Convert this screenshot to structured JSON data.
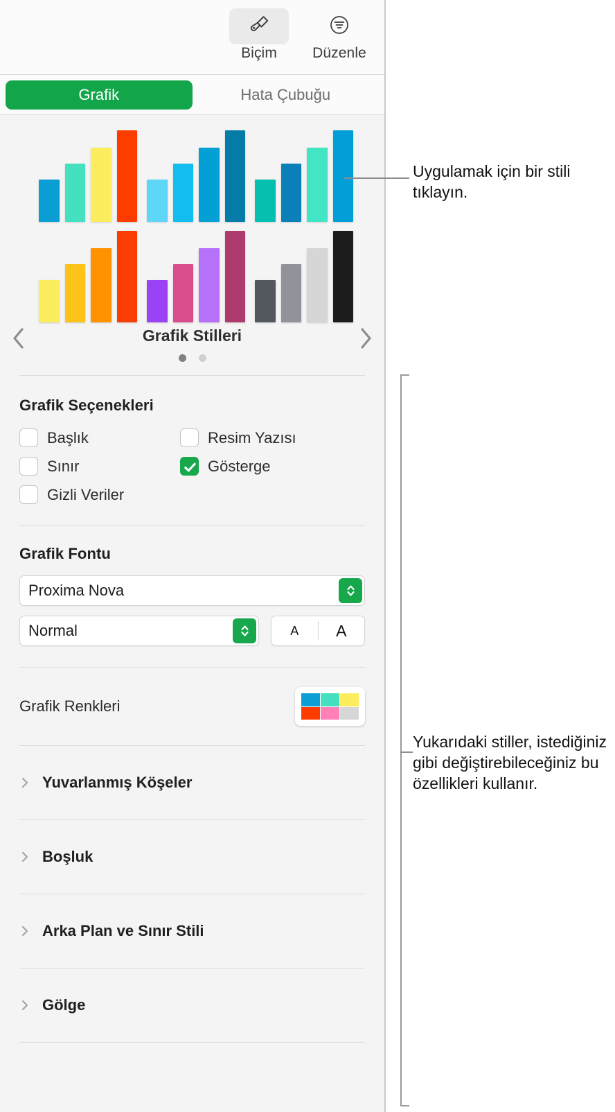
{
  "toolbar": {
    "buttons": [
      {
        "label": "Biçim",
        "icon": "paintbrush-icon",
        "active": true
      },
      {
        "label": "Düzenle",
        "icon": "edit-lines-circle-icon",
        "active": false
      }
    ]
  },
  "tabs": [
    {
      "label": "Grafik",
      "selected": true
    },
    {
      "label": "Hata Çubuğu",
      "selected": false
    }
  ],
  "carousel": {
    "title": "Grafik Stilleri",
    "prev_icon": "chevron-left-icon",
    "next_icon": "chevron-right-icon",
    "page_count": 2,
    "active_page": 1,
    "styles": [
      {
        "name": "style-1",
        "colors": [
          "#0a9ed4",
          "#44e0c0",
          "#fbed5e",
          "#ff3c00"
        ],
        "heights": [
          46,
          64,
          81,
          100
        ]
      },
      {
        "name": "style-2",
        "colors": [
          "#5ed6f7",
          "#12bdf0",
          "#02a0d4",
          "#057ca8"
        ],
        "heights": [
          46,
          64,
          81,
          100
        ]
      },
      {
        "name": "style-3",
        "colors": [
          "#07bfae",
          "#0b80b8",
          "#42e6c4",
          "#029ed8"
        ],
        "heights": [
          46,
          64,
          81,
          100
        ]
      },
      {
        "name": "style-4",
        "colors": [
          "#fbed5e",
          "#fcc31a",
          "#ff9200",
          "#fa3c05"
        ],
        "heights": [
          46,
          64,
          81,
          100
        ]
      },
      {
        "name": "style-5",
        "colors": [
          "#9b42f5",
          "#d94d8c",
          "#b772fb",
          "#ad3b6e"
        ],
        "heights": [
          46,
          64,
          81,
          100
        ]
      },
      {
        "name": "style-6",
        "colors": [
          "#53585f",
          "#92939a",
          "#d6d6d6",
          "#1c1c1c"
        ],
        "heights": [
          46,
          64,
          81,
          100
        ]
      }
    ]
  },
  "chart_options": {
    "title": "Grafik Seçenekleri",
    "checkboxes": [
      {
        "label": "Başlık",
        "checked": false
      },
      {
        "label": "Resim Yazısı",
        "checked": false
      },
      {
        "label": "Sınır",
        "checked": false
      },
      {
        "label": "Gösterge",
        "checked": true
      },
      {
        "label": "Gizli Veriler",
        "checked": false
      }
    ]
  },
  "chart_font": {
    "title": "Grafik Fontu",
    "family": "Proxima Nova",
    "style": "Normal",
    "size_decrease": "A",
    "size_increase": "A"
  },
  "chart_colors": {
    "label": "Grafik Renkleri",
    "swatches": [
      "#0a9ed4",
      "#44e0c0",
      "#fbed5e",
      "#ff3c00",
      "#ff7fb6",
      "#d6d6d6"
    ]
  },
  "disclosure_sections": [
    {
      "label": "Yuvarlanmış Köşeler"
    },
    {
      "label": "Boşluk"
    },
    {
      "label": "Arka Plan ve Sınır Stili"
    },
    {
      "label": "Gölge"
    }
  ],
  "callouts": {
    "top": "Uygulamak için bir stili tıklayın.",
    "bottom": "Yukarıdaki stiller, istediğiniz gibi değiştirebileceğiniz bu özellikleri kullanır."
  },
  "accent_color": "#13a54a"
}
